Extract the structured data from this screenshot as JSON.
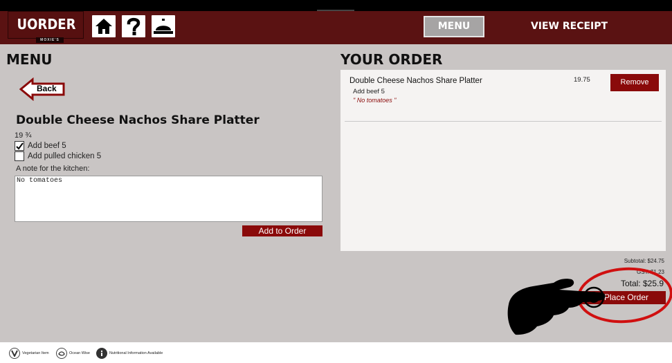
{
  "header": {
    "logo_text": "UORDER",
    "logo_sub": "MOXIE'S",
    "nav_menu": "MENU",
    "nav_receipt": "VIEW RECEIPT",
    "icons": [
      "home-icon",
      "help-icon",
      "service-bell-icon"
    ]
  },
  "menu": {
    "title": "MENU",
    "back_label": "Back",
    "item_name": "Double Cheese Nachos Share Platter",
    "item_price": "19 ¾",
    "options": [
      {
        "label": "Add beef 5",
        "checked": true
      },
      {
        "label": "Add pulled chicken 5",
        "checked": false
      }
    ],
    "note_label": "A note for the kitchen:",
    "note_value": "No tomatoes",
    "add_button": "Add to Order"
  },
  "order": {
    "title": "YOUR ORDER",
    "items": [
      {
        "name": "Double Cheese Nachos Share Platter",
        "price": "19.75",
        "remove_label": "Remove",
        "modifier": "Add beef 5",
        "note": "\" No tomatoes \""
      }
    ],
    "subtotal": "Subtotal: $24.75",
    "gst": "GST: $1.23",
    "total": "Total: $25.9",
    "place_order": "Place Order"
  },
  "footer": {
    "legend": [
      {
        "icon": "vegetarian-icon",
        "label": "Vegetarian Item"
      },
      {
        "icon": "ocean-wise-icon",
        "label": "Ocean Wise"
      },
      {
        "icon": "info-icon",
        "label": "Nutritional Information Available"
      }
    ]
  },
  "colors": {
    "header_bg": "#5a1212",
    "content_bg": "#c9c5c4",
    "accent": "#8a0a0a",
    "annotation_circle": "#d01010"
  }
}
